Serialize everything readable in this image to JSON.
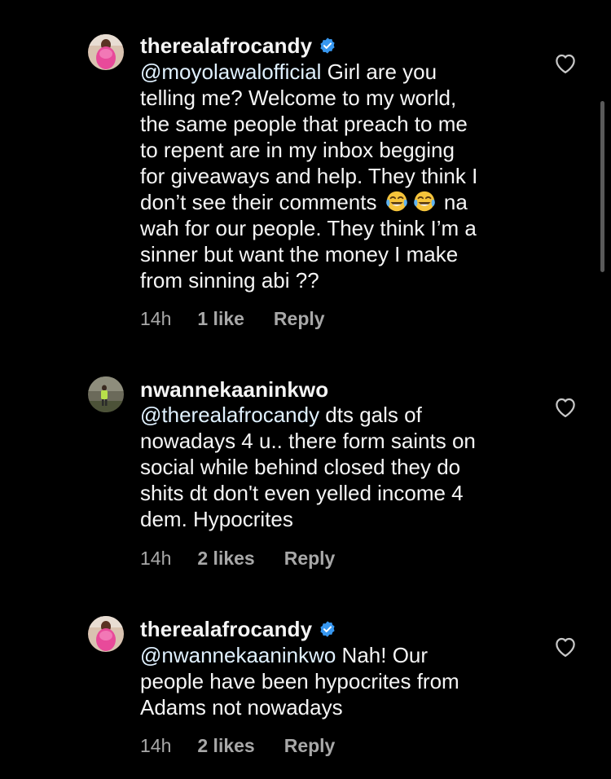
{
  "colors": {
    "background": "#000000",
    "text_primary": "#f5f5f5",
    "text_secondary": "#a8a8a8",
    "verified_blue": "#3797f0"
  },
  "comments": [
    {
      "username": "therealafrocandy",
      "verified": true,
      "avatar_icon": "profile-photo-pink",
      "mention": "@moyolawalofficial",
      "lines": [
        " Girl are you",
        "telling me? Welcome to my world,",
        "the same people that preach to me",
        "to repent are in my inbox begging",
        "for giveaways and help. They think I",
        "don’t see their comments ",
        "wah for our people. They think I’m a",
        "sinner but want the money I make",
        "from sinning abi ??"
      ],
      "line6_tail": " na",
      "emoji": "face-with-tears-of-joy",
      "time": "14h",
      "likes": "1 like",
      "reply": "Reply"
    },
    {
      "username": "nwannekaaninkwo",
      "verified": false,
      "avatar_icon": "profile-photo-outdoor",
      "mention": "@therealafrocandy",
      "lines": [
        " dts gals of",
        "nowadays 4 u.. there form saints on",
        "social while behind closed they do",
        "shits dt don't even yelled income 4",
        "dem. Hypocrites"
      ],
      "time": "14h",
      "likes": "2 likes",
      "reply": "Reply"
    },
    {
      "username": "therealafrocandy",
      "verified": true,
      "avatar_icon": "profile-photo-pink",
      "mention": "@nwannekaaninkwo",
      "lines": [
        " Nah! Our",
        "people have been hypocrites from",
        "Adams not nowadays"
      ],
      "time": "14h",
      "likes": "2 likes",
      "reply": "Reply"
    }
  ]
}
